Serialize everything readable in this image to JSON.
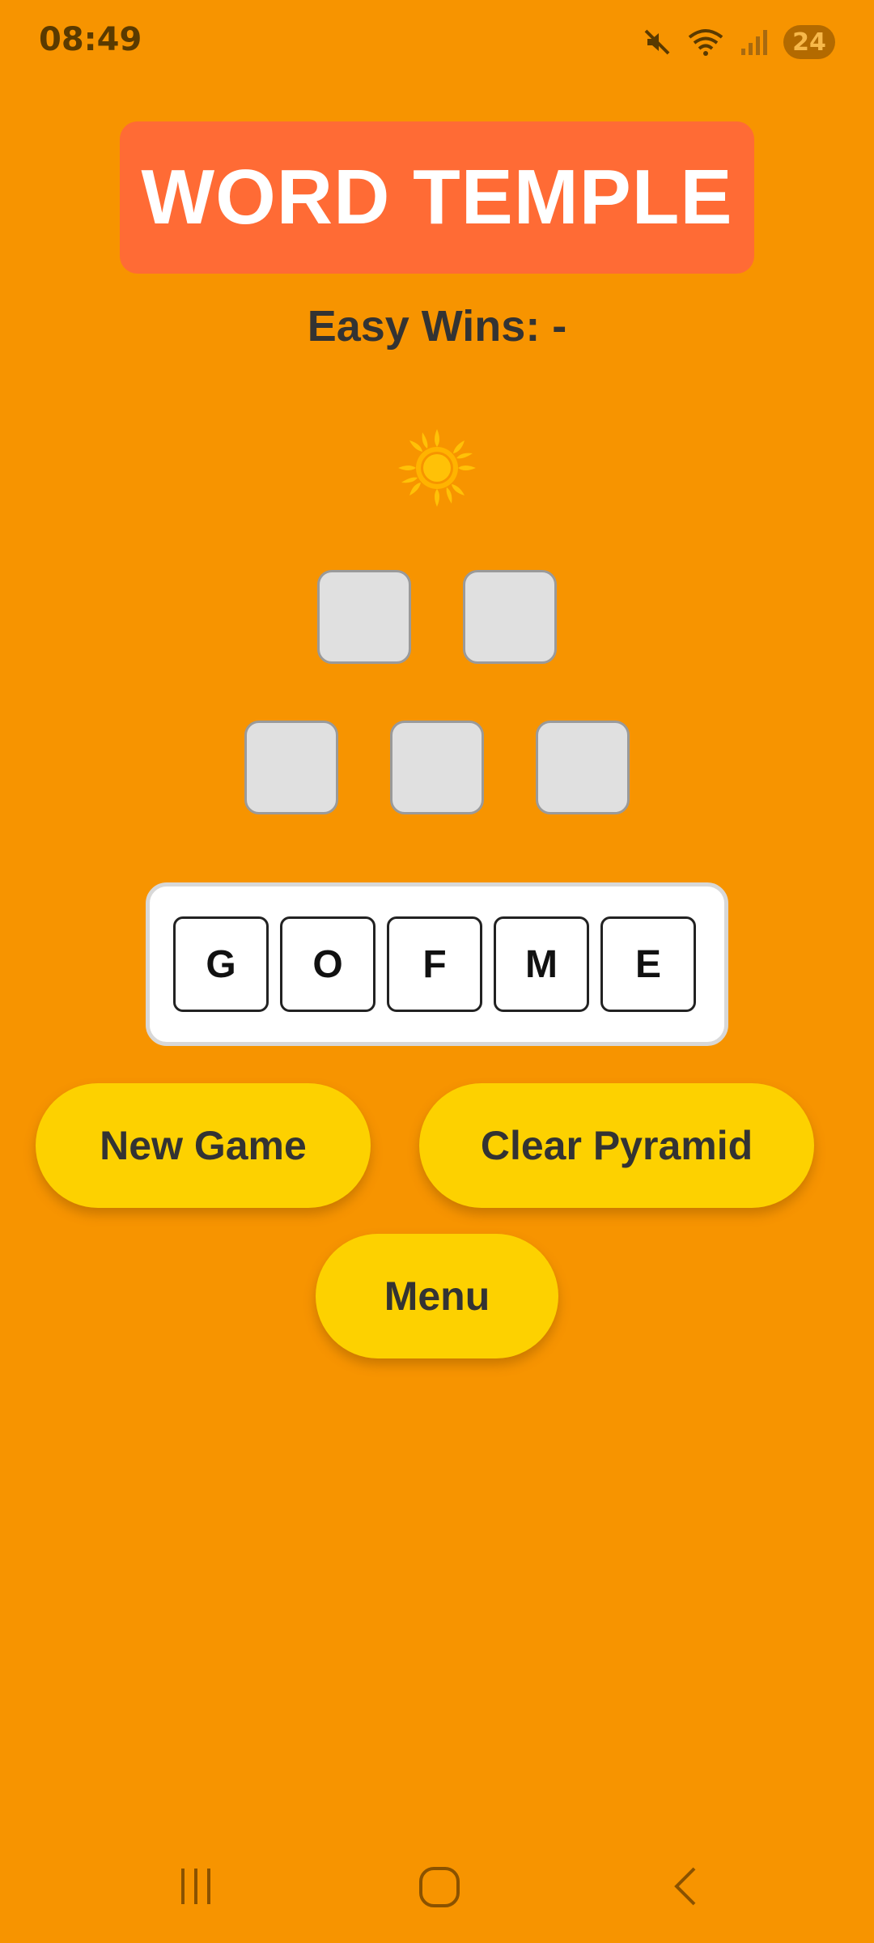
{
  "status_bar": {
    "time": "08:49",
    "battery": "24",
    "icons": [
      "mute-icon",
      "wifi-icon",
      "signal-icon",
      "battery-icon"
    ]
  },
  "game": {
    "title": "WORD TEMPLE",
    "wins_label": "Easy Wins: -",
    "theme_icon": "sun-icon",
    "pyramid_rows": [
      2,
      3
    ],
    "letters": [
      "G",
      "O",
      "F",
      "M",
      "E"
    ]
  },
  "buttons": {
    "new_game": "New Game",
    "clear_pyramid": "Clear Pyramid",
    "menu": "Menu"
  },
  "navigation": {
    "icons": [
      "recent-apps-icon",
      "home-icon",
      "back-icon"
    ]
  },
  "colors": {
    "background": "#F79400",
    "title_banner": "#FF6B35",
    "button": "#FDD100",
    "slot": "#E0E0E0",
    "sun": "#FFC107"
  }
}
